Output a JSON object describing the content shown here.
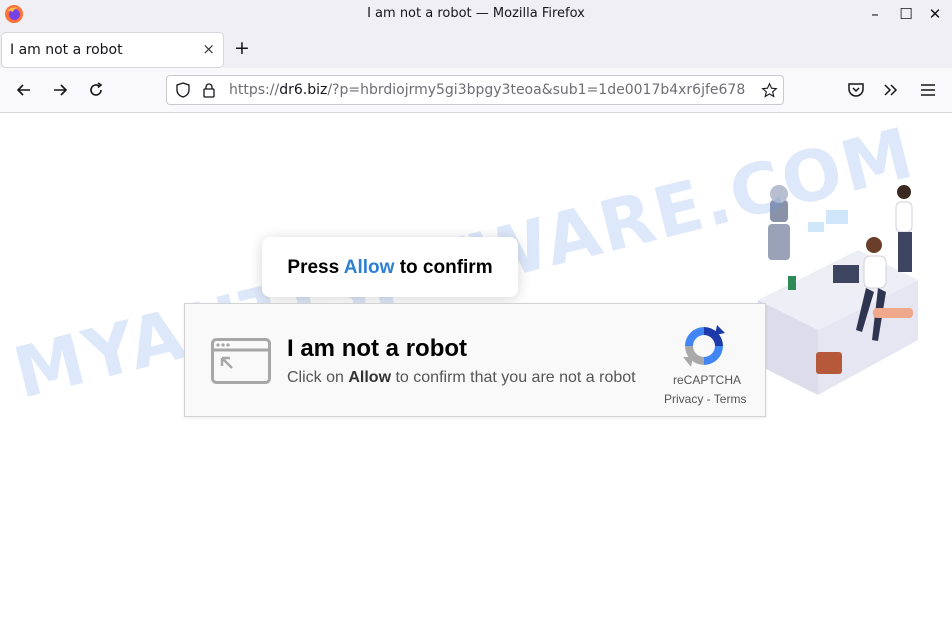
{
  "window": {
    "title": "I am not a robot — Mozilla Firefox",
    "controls": {
      "minimize": "–",
      "maximize": "☐",
      "close": "✕"
    }
  },
  "tab": {
    "label": "I am not a robot",
    "close_symbol": "×"
  },
  "new_tab_symbol": "+",
  "url": {
    "prefix": "https://",
    "domain": "dr6.biz",
    "rest": "/?p=hbrdiojrmy5gi3bpgy3teoa&sub1=1de0017b4xr6jfe678"
  },
  "page": {
    "press_prefix": "Press ",
    "press_allow": "Allow",
    "press_suffix": " to confirm",
    "captcha_title": "I am not a robot",
    "captcha_sub_prefix": "Click on ",
    "captcha_sub_allow": "Allow",
    "captcha_sub_suffix": " to confirm that you are not a robot",
    "recaptcha_label": "reCAPTCHA",
    "recaptcha_links": "Privacy - Terms",
    "watermark": "MYANTISPYWARE.COM"
  },
  "colors": {
    "allow_blue": "#2f80d1",
    "chrome_bg": "#f0f0f4",
    "watermark": "#6496e6"
  },
  "icons": [
    "firefox-logo",
    "back-icon",
    "forward-icon",
    "reload-icon",
    "shield-icon",
    "lock-icon",
    "star-icon",
    "pocket-icon",
    "overflow-icon",
    "menu-icon",
    "browser-window-icon",
    "recaptcha-logo"
  ]
}
